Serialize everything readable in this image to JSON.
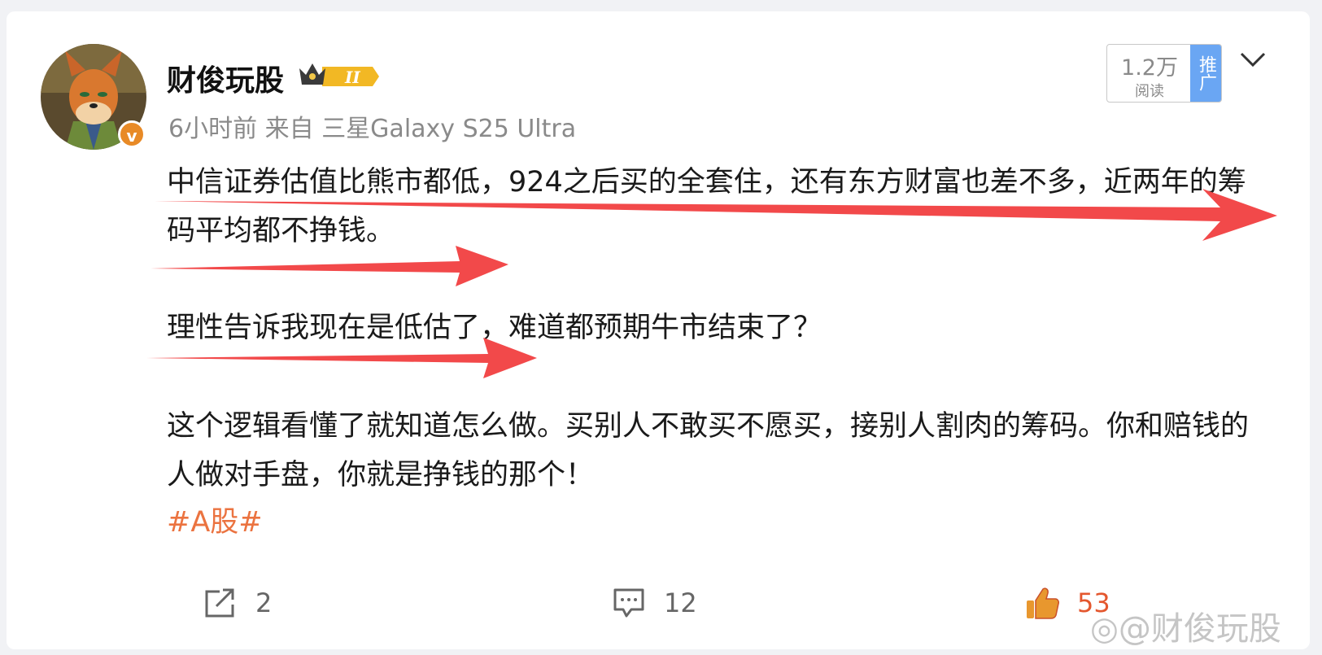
{
  "post": {
    "username": "财俊玩股",
    "member_badge_text": "II",
    "time": "6小时前",
    "source_prefix": "来自",
    "device": "三星Galaxy S25 Ultra",
    "reads": {
      "count": "1.2万",
      "label": "阅读",
      "promote": "推广"
    },
    "paragraphs": [
      "中信证券估值比熊市都低，924之后买的全套住，还有东方财富也差不多，近两年的筹码平均都不挣钱。",
      "理性告诉我现在是低估了，难道都预期牛市结束了？",
      "这个逻辑看懂了就知道怎么做。买别人不敢买不愿买，接别人割肉的筹码。你和赔钱的人做对手盘，你就是挣钱的那个！"
    ],
    "hashtag": "#A股#"
  },
  "actions": {
    "share_count": "2",
    "comment_count": "12",
    "like_count": "53"
  },
  "watermark": "@财俊玩股",
  "colors": {
    "accent_orange": "#eb7340",
    "arrow_red": "#f2494a",
    "promote_blue": "#6aa6f3"
  },
  "icons": [
    "avatar-fox",
    "verified-v-icon",
    "crown-badge-icon",
    "chevron-down-icon",
    "share-icon",
    "comment-icon",
    "thumbs-up-icon",
    "weibo-logo-icon"
  ]
}
